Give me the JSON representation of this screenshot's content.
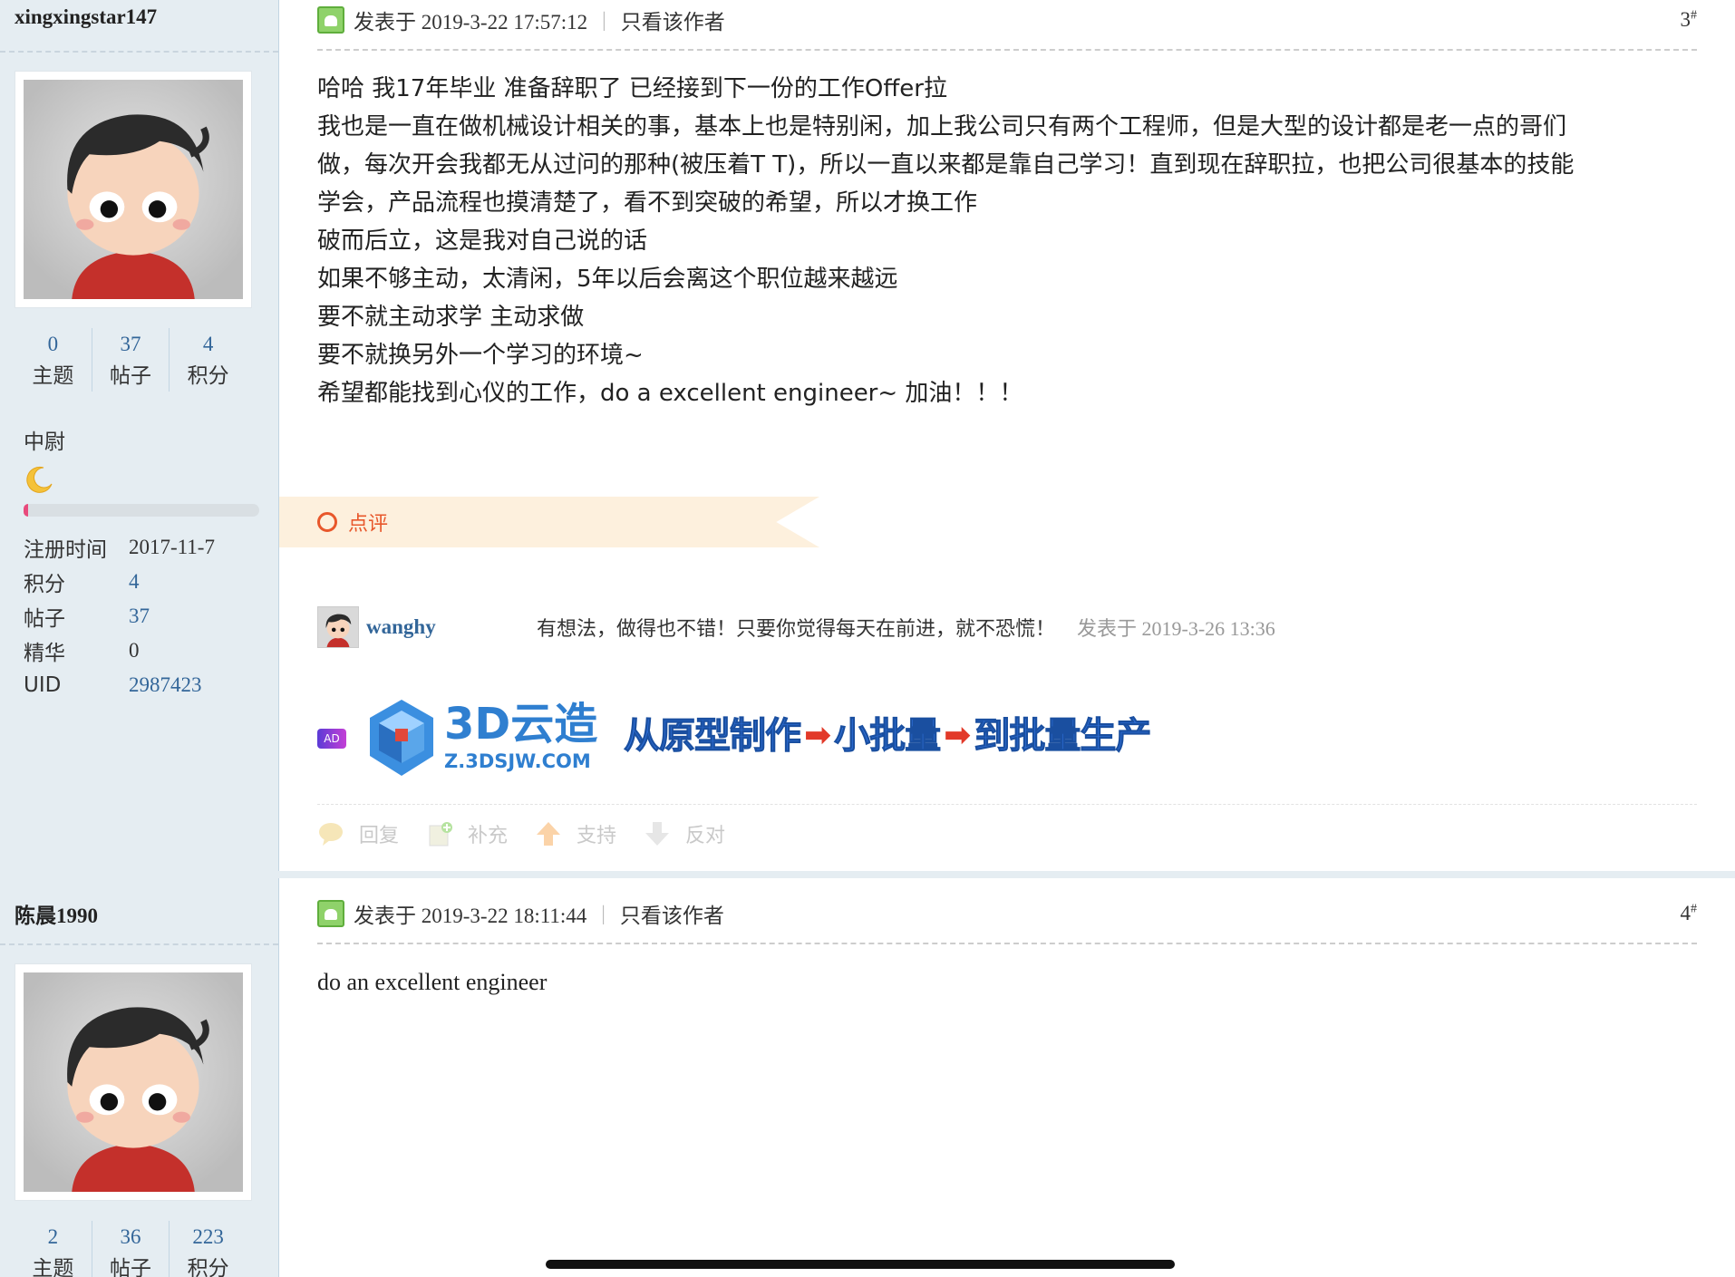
{
  "posts": [
    {
      "author": {
        "username": "xingxingstar147",
        "stats": [
          {
            "value": "0",
            "label": "主题"
          },
          {
            "value": "37",
            "label": "帖子"
          },
          {
            "value": "4",
            "label": "积分"
          }
        ],
        "rank": "中尉",
        "rank_progress": 0.02,
        "info": [
          {
            "key": "注册时间",
            "value": "2017-11-7"
          },
          {
            "key": "积分",
            "value": "4"
          },
          {
            "key": "帖子",
            "value": "37"
          },
          {
            "key": "精华",
            "value": "0"
          },
          {
            "key": "UID",
            "value": "2987423"
          }
        ]
      },
      "posted": "发表于 2019-3-22 17:57:12",
      "only_author": "只看该作者",
      "floor": "3",
      "floor_mark": "#",
      "body": [
        "哈哈 我17年毕业 准备辞职了 已经接到下一份的工作Offer拉",
        "我也是一直在做机械设计相关的事，基本上也是特别闲，加上我公司只有两个工程师，但是大型的设计都是老一点的哥们",
        "做，每次开会我都无从过问的那种(被压着T T)，所以一直以来都是靠自己学习！直到现在辞职拉，也把公司很基本的技能",
        "学会，产品流程也摸清楚了，看不到突破的希望，所以才换工作",
        "",
        "破而后立，这是我对自己说的话",
        "如果不够主动，太清闲，5年以后会离这个职位越来越远",
        "要不就主动求学 主动求做",
        "要不就换另外一个学习的环境~",
        "希望都能找到心仪的工作，do a excellent engineer~ 加油！！！"
      ],
      "comment_tab": "点评",
      "comment": {
        "user": "wanghy",
        "text": "有想法，做得也不错！只要你觉得每天在前进，就不恐慌！",
        "time": "发表于 2019-3-26 13:36"
      },
      "ad": {
        "badge": "AD",
        "brand": "3D云造",
        "url": "Z.3DSJW.COM",
        "slogan": [
          "从原型制作",
          "小批量",
          "到批量生产"
        ]
      },
      "actions": [
        "回复",
        "补充",
        "支持",
        "反对"
      ]
    },
    {
      "author": {
        "username": "陈晨1990",
        "stats": [
          {
            "value": "2",
            "label": "主题"
          },
          {
            "value": "36",
            "label": "帖子"
          },
          {
            "value": "223",
            "label": "积分"
          }
        ]
      },
      "posted": "发表于 2019-3-22 18:11:44",
      "only_author": "只看该作者",
      "floor": "4",
      "floor_mark": "#",
      "body": [
        "do an excellent engineer"
      ]
    }
  ],
  "colors": {
    "sidebar_bg": "#e5edf2",
    "link": "#336699",
    "comment_accent": "#e8572b",
    "comment_tab_bg": "#fdf0dd"
  },
  "icons": [
    "avatar-cartoon",
    "post-image-icon",
    "moon-icon",
    "ring-icon",
    "reply-icon",
    "supplement-icon",
    "thumbs-up-icon",
    "thumbs-down-icon"
  ]
}
